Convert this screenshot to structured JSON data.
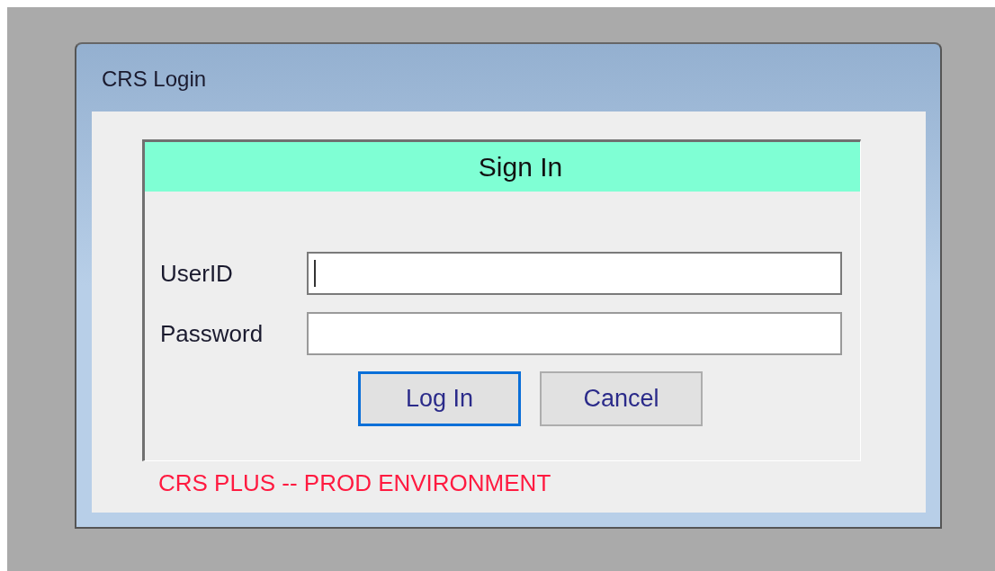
{
  "window": {
    "title": "CRS Login"
  },
  "panel": {
    "heading": "Sign In"
  },
  "fields": [
    {
      "label": "UserID",
      "focused": true
    },
    {
      "label": "Password",
      "focused": false
    }
  ],
  "buttons": [
    {
      "label": "Log In",
      "focused": true
    },
    {
      "label": "Cancel",
      "focused": false
    }
  ],
  "environment_note": "CRS PLUS -- PROD ENVIRONMENT"
}
